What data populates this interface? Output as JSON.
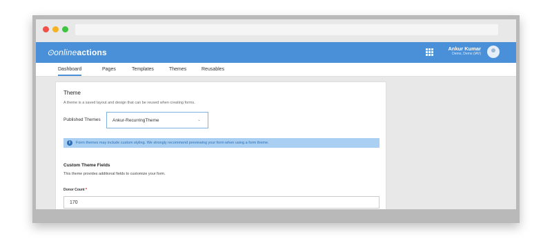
{
  "window": {
    "dot_colors": [
      "#f0504a",
      "#f5b323",
      "#3ec441"
    ]
  },
  "app": {
    "logo_light": "online",
    "logo_bold": "actions",
    "user_name": "Ankur Kumar",
    "user_org": "Demo, Demo (IAV)",
    "brand_color": "#4a90d9"
  },
  "tabs": [
    {
      "label": "Dashboard"
    },
    {
      "label": "Pages"
    },
    {
      "label": "Templates"
    },
    {
      "label": "Themes"
    },
    {
      "label": "Reusables"
    }
  ],
  "theme": {
    "title": "Theme",
    "description": "A theme is a saved layout and design that can be reused when creating forms.",
    "published_label": "Published Themes",
    "selected_theme": "Ankur-RecurringTheme",
    "info_text": "Form themes may include custom styling. We strongly recommend previewing your form when using a form theme."
  },
  "custom_fields": {
    "title": "Custom Theme Fields",
    "description": "This theme provides additional fields to customize your form.",
    "donor_count_label": "Donor Count",
    "required_mark": "*",
    "donor_count_value": "170"
  },
  "icons": [
    "grid-apps-icon",
    "user-avatar-icon",
    "info-icon",
    "chevron-down-icon"
  ]
}
